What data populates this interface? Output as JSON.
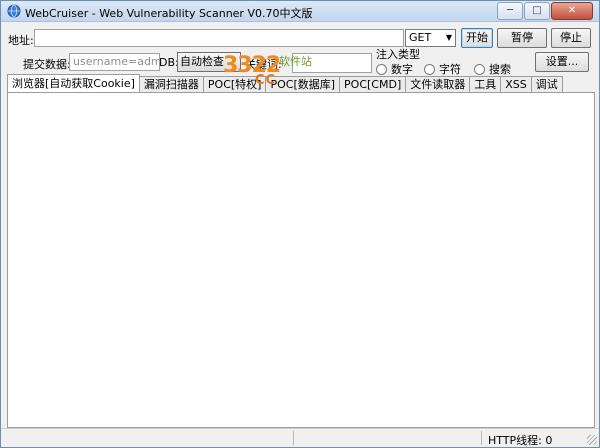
{
  "window": {
    "title": "WebCruiser - Web Vulnerability Scanner V0.70中文版"
  },
  "toolbar": {
    "url_label": "地址:",
    "url_value": "",
    "method": "GET",
    "start": "开始",
    "pause": "暂停",
    "stop": "停止",
    "settings": "设置..."
  },
  "form": {
    "post_label": "提交数据:",
    "post_value": "username=admin",
    "db_label": "DB:",
    "db_value": "自动检查",
    "keyword_label": "关键词:",
    "keyword_value": "",
    "inject_label": "注入类型",
    "inject_options": [
      "数字",
      "字符",
      "搜索"
    ]
  },
  "tabs": [
    "浏览器[自动获取Cookie]",
    "漏洞扫描器",
    "POC[特权]",
    "POC[数据库]",
    "POC[CMD]",
    "文件读取器",
    "工具",
    "XSS",
    "调试"
  ],
  "status": {
    "http_threads": "HTTP线程: 0"
  },
  "watermark": {
    "number": "3322",
    "text": "软件站",
    "suffix": "CC"
  }
}
